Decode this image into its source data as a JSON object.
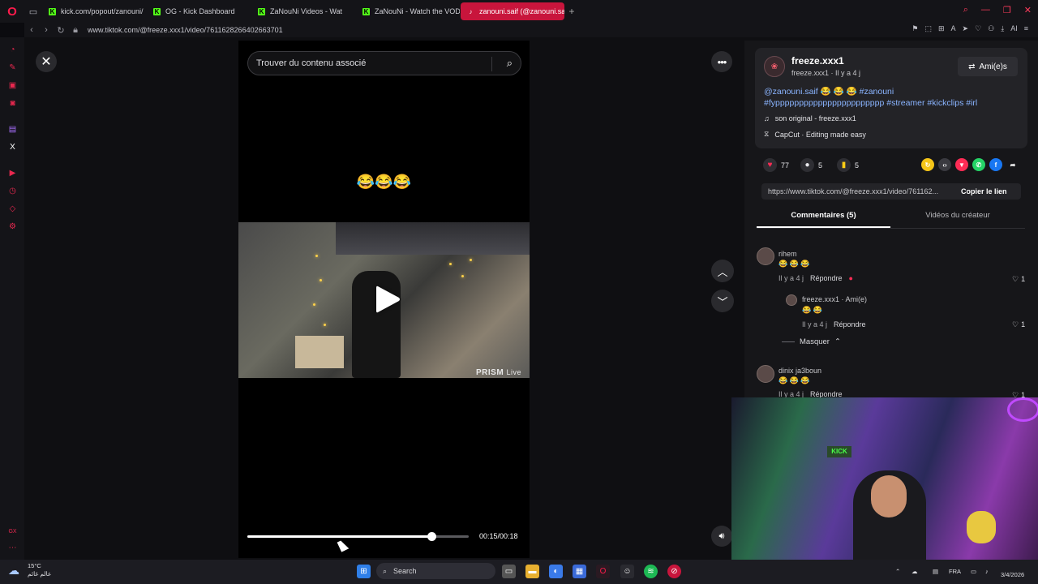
{
  "browser": {
    "tabs": [
      {
        "label": "kick.com/popout/zanouni/",
        "icon": "kick"
      },
      {
        "label": "OG - Kick Dashboard",
        "icon": "kick"
      },
      {
        "label": "ZaNouNi Videos - Wat",
        "icon": "kick"
      },
      {
        "label": "ZaNouNi - Watch the VOD",
        "icon": "kick"
      },
      {
        "label": "zanouni.saif (@zanouni.sa",
        "icon": "tiktok"
      }
    ],
    "url": "www.tiktok.com/@freeze.xxx1/video/7611628266402663701"
  },
  "video": {
    "search_placeholder": "Trouver du contenu associé",
    "caption_emojis": "😂😂😂",
    "watermark": "PRISM",
    "watermark_sub": "Live",
    "time": "00:15/00:18",
    "progress": 0.83
  },
  "author": {
    "name": "freeze.xxx1",
    "subtitle": "freeze.xxx1 · Il y a 4 j",
    "friends_label": "Ami(e)s",
    "caption_mention": "@zanouni.saif",
    "caption_emojis": "😂 😂 😂",
    "caption_tags": "#zanouni #fyppppppppppppppppppppppp #streamer #kickclips #irl",
    "music": "son original - freeze.xxx1",
    "capcut": "CapCut · Editing made easy"
  },
  "stats": {
    "likes": "77",
    "comments": "5",
    "saves": "5"
  },
  "link": {
    "url": "https://www.tiktok.com/@freeze.xxx1/video/761162...",
    "copy_label": "Copier le lien"
  },
  "tabs": {
    "comments": "Commentaires (5)",
    "creator_videos": "Vidéos du créateur"
  },
  "comments": [
    {
      "name": "rihem",
      "text": "😂 😂 😂",
      "time": "Il y a 4 j",
      "reply": "Répondre",
      "likes": "1"
    },
    {
      "name": "freeze.xxx1 · Ami(e)",
      "text": "😂 😂",
      "time": "Il y a 4 j",
      "reply": "Répondre",
      "likes": "1"
    },
    {
      "name": "dinix ja3boun",
      "text": "😂 😂 😂",
      "time": "Il y a 4 j",
      "reply": "Répondre",
      "likes": "1"
    }
  ],
  "hide_replies": "Masquer",
  "taskbar": {
    "temp": "15°C",
    "weather_text": "عالم غائم",
    "search": "Search",
    "lang": "FRA",
    "date": "3/4/2026"
  },
  "webcam": {
    "sign_text": "KICK"
  }
}
